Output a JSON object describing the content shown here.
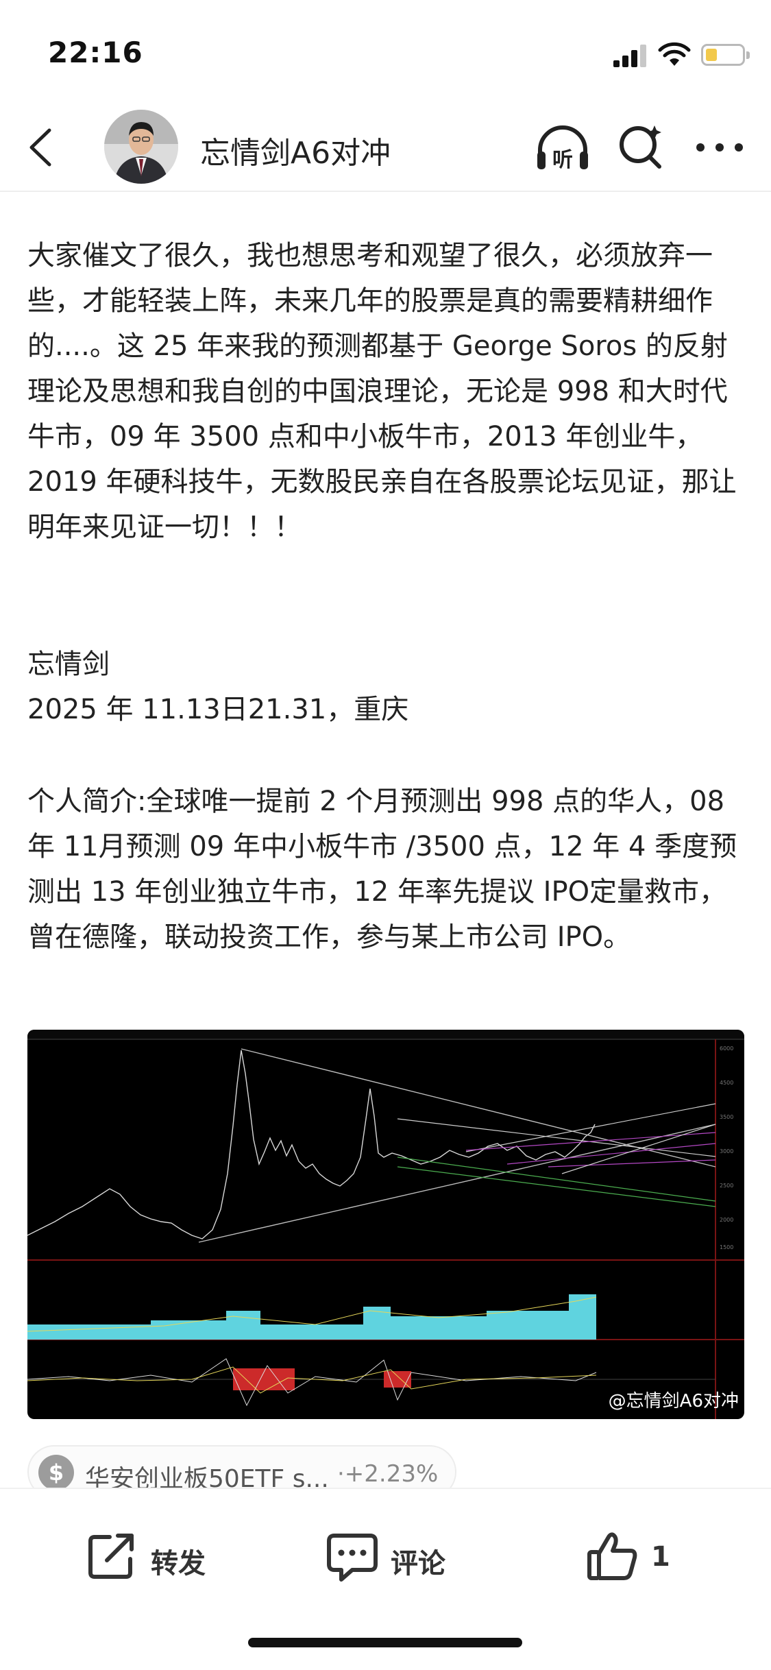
{
  "status_bar": {
    "time": "22:16"
  },
  "header": {
    "title": "忘情剑A6对冲"
  },
  "article": {
    "paragraph1": "大家催文了很久，我也想思考和观望了很久，必须放弃一些，才能轻装上阵，未来几年的股票是真的需要精耕细作的....。这 25 年来我的预测都基于 George Soros 的反射理论及思想和我自创的中国浪理论，无论是 998 和大时代牛市，09 年 3500 点和中小板牛市，2013 年创业牛，2019 年硬科技牛，无数股民亲自在各股票论坛见证，那让明年来见证一切！！！",
    "signature": "忘情剑",
    "date_line": "2025 年 11.13日21.31，重庆",
    "bio": "个人简介:全球唯一提前 2 个月预测出 998 点的华人，08 年 11月预测 09 年中小板牛市 /3500 点，12 年 4 季度预测出 13 年创业独立牛市，12 年率先提议 IPO定量救市，曾在德隆，联动投资工作，参与某上市公司 IPO。"
  },
  "image": {
    "watermark": "@忘情剑A6对冲"
  },
  "stock_chip": {
    "name": "华安创业板50ETF s...",
    "change": "·+2.23%"
  },
  "toolbar": {
    "repost_label": "转发",
    "comment_label": "评论",
    "like_count": "1"
  },
  "colors": {
    "text": "#222222",
    "chart_bg": "#000000",
    "chip_gray": "#9c9c9c"
  }
}
